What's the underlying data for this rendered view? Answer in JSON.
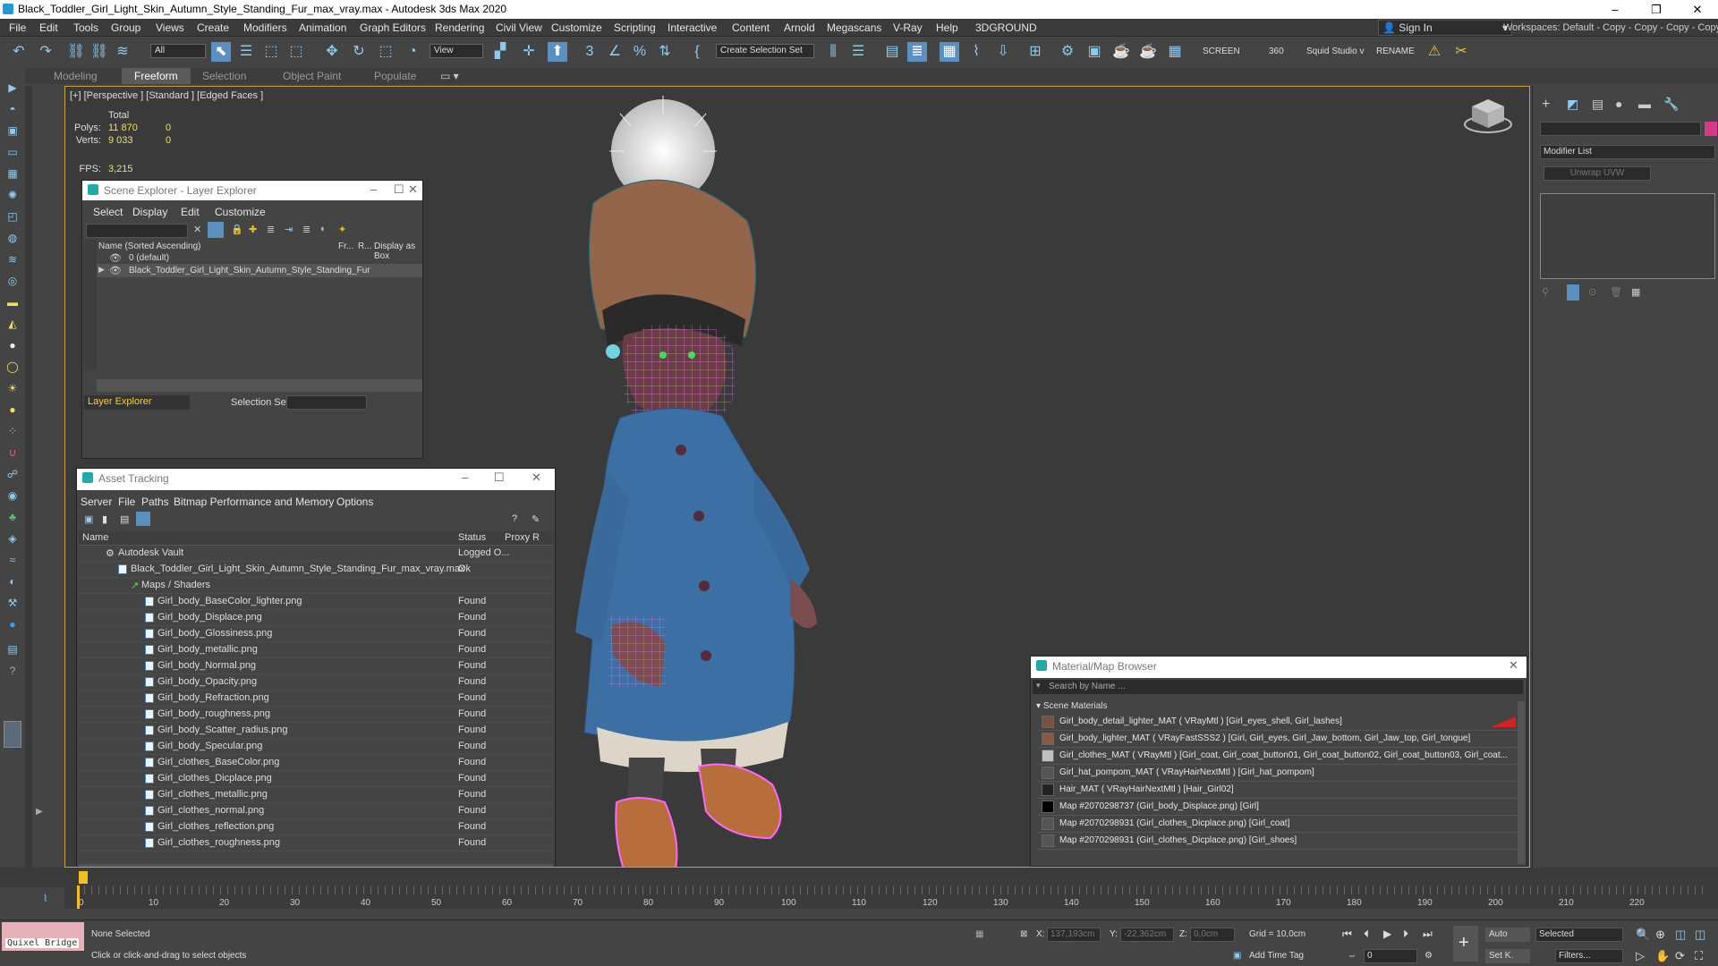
{
  "window": {
    "title": "Black_Toddler_Girl_Light_Skin_Autumn_Style_Standing_Fur_max_vray.max - Autodesk 3ds Max 2020"
  },
  "menubar": [
    "File",
    "Edit",
    "Tools",
    "Group",
    "Views",
    "Create",
    "Modifiers",
    "Animation",
    "Graph Editors",
    "Rendering",
    "Civil View",
    "Customize",
    "Scripting",
    "Interactive",
    "Content",
    "Arnold",
    "Megascans",
    "V-Ray",
    "Help",
    "3DGROUND"
  ],
  "account": {
    "signin": "Sign In"
  },
  "workspaces": "Workspaces: Default - Copy - Copy - Copy - Copy",
  "toolbar": {
    "filter": "All",
    "refcoord": "View",
    "named_selection": "Create Selection Set",
    "screen": "SCREEN",
    "num360": "360",
    "squid": "Squid Studio v",
    "rename": "RENAME"
  },
  "ribbon": {
    "tabs": [
      "Modeling",
      "Freeform",
      "Selection",
      "Object Paint",
      "Populate"
    ],
    "active": "Freeform"
  },
  "viewport": {
    "label": "[+] [Perspective ] [Standard ] [Edged Faces ]",
    "stats": {
      "total_label": "Total",
      "polys_label": "Polys:",
      "polys": "11 870",
      "polys_sel": "0",
      "verts_label": "Verts:",
      "verts": "9 033",
      "verts_sel": "0",
      "fps_label": "FPS:",
      "fps": "3,215"
    }
  },
  "scene_explorer": {
    "title": "Scene Explorer - Layer Explorer",
    "menus": [
      "Select",
      "Display",
      "Edit",
      "Customize"
    ],
    "columns": [
      "Name (Sorted Ascending)",
      "Fr...",
      "R...",
      "Display as Box"
    ],
    "rows": [
      "0 (default)",
      "Black_Toddler_Girl_Light_Skin_Autumn_Style_Standing_Fur"
    ],
    "footer_mode": "Layer Explorer",
    "selection_set_label": "Selection Set:"
  },
  "asset_tracking": {
    "title": "Asset Tracking",
    "menus": [
      "Server",
      "File",
      "Paths",
      "Bitmap Performance and Memory",
      "Options"
    ],
    "columns": [
      "Name",
      "Status",
      "Proxy R"
    ],
    "vault": {
      "name": "Autodesk Vault",
      "status": "Logged O..."
    },
    "file": {
      "name": "Black_Toddler_Girl_Light_Skin_Autumn_Style_Standing_Fur_max_vray.max",
      "status": "Ok"
    },
    "group": "Maps / Shaders",
    "maps": [
      {
        "name": "Girl_body_BaseColor_lighter.png",
        "status": "Found"
      },
      {
        "name": "Girl_body_Displace.png",
        "status": "Found"
      },
      {
        "name": "Girl_body_Glossiness.png",
        "status": "Found"
      },
      {
        "name": "Girl_body_metallic.png",
        "status": "Found"
      },
      {
        "name": "Girl_body_Normal.png",
        "status": "Found"
      },
      {
        "name": "Girl_body_Opacity.png",
        "status": "Found"
      },
      {
        "name": "Girl_body_Refraction.png",
        "status": "Found"
      },
      {
        "name": "Girl_body_roughness.png",
        "status": "Found"
      },
      {
        "name": "Girl_body_Scatter_radius.png",
        "status": "Found"
      },
      {
        "name": "Girl_body_Specular.png",
        "status": "Found"
      },
      {
        "name": "Girl_clothes_BaseColor.png",
        "status": "Found"
      },
      {
        "name": "Girl_clothes_Dicplace.png",
        "status": "Found"
      },
      {
        "name": "Girl_clothes_metallic.png",
        "status": "Found"
      },
      {
        "name": "Girl_clothes_normal.png",
        "status": "Found"
      },
      {
        "name": "Girl_clothes_reflection.png",
        "status": "Found"
      },
      {
        "name": "Girl_clothes_roughness.png",
        "status": "Found"
      }
    ]
  },
  "material_browser": {
    "title": "Material/Map Browser",
    "search_placeholder": "Search by Name ...",
    "section": "Scene Materials",
    "items": [
      "Girl_body_detail_lighter_MAT  ( VRayMtl )  [Girl_eyes_shell, Girl_lashes]",
      "Girl_body_lighter_MAT  ( VRayFastSSS2 )  [Girl, Girl_eyes, Girl_Jaw_bottom, Girl_Jaw_top, Girl_tongue]",
      "Girl_clothes_MAT  ( VRayMtl )  [Girl_coat, Girl_coat_button01, Girl_coat_button02, Girl_coat_button03, Girl_coat...",
      "Girl_hat_pompom_MAT  ( VRayHairNextMtl )  [Girl_hat_pompom]",
      "Hair_MAT  ( VRayHairNextMtl )  [Hair_Girl02]",
      "Map #2070298737 (Girl_body_Displace.png)  [Girl]",
      "Map #2070298931 (Girl_clothes_Dicplace.png)  [Girl_coat]",
      "Map #2070298931 (Girl_clothes_Dicplace.png)  [Girl_shoes]"
    ]
  },
  "command_panel": {
    "modifier_list": "Modifier List",
    "unwrap": "Unwrap UVW"
  },
  "timeline": {
    "ticks": [
      "0",
      "10",
      "20",
      "30",
      "40",
      "50",
      "60",
      "70",
      "80",
      "90",
      "100",
      "110",
      "120",
      "130",
      "140",
      "150",
      "160",
      "170",
      "180",
      "190",
      "200",
      "210",
      "220"
    ]
  },
  "status": {
    "quixel": "Quixel Bridge",
    "selection": "None Selected",
    "prompt": "Click or click-and-drag to select objects",
    "x_label": "X:",
    "x": "137,193cm",
    "y_label": "Y:",
    "y": "-22,362cm",
    "z_label": "Z:",
    "z": "0,0cm",
    "grid": "Grid = 10,0cm",
    "add_time_tag": "Add Time Tag",
    "auto": "Auto",
    "selected": "Selected",
    "set_key": "Set K.",
    "filters": "Filters...",
    "frame": "0"
  }
}
